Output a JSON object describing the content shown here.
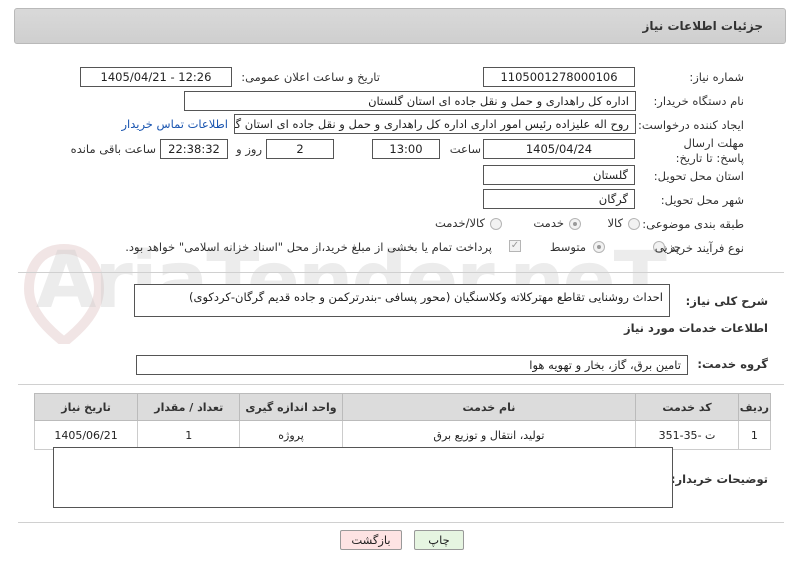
{
  "header": {
    "title": "جزئیات اطلاعات نیاز"
  },
  "watermark": {
    "text": "AriaTender.neT"
  },
  "fields": {
    "need_number_label": "شماره نیاز:",
    "need_number": "1105001278000106",
    "announce_label": "تاریخ و ساعت اعلان عمومی:",
    "announce_value": "1405/04/21 - 12:26",
    "buyer_label": "نام دستگاه خریدار:",
    "buyer_value": "اداره کل راهداری و حمل و نقل جاده ای استان گلستان",
    "creator_label": "ایجاد کننده درخواست:",
    "creator_value": "روح اله علیزاده رئیس امور اداری اداره کل راهداری و حمل و نقل جاده ای استان گلستان",
    "contact_link": "اطلاعات تماس خریدار",
    "deadline_label": "مهلت ارسال پاسخ: تا تاریخ:",
    "deadline_date": "1405/04/24",
    "time_label": "ساعت",
    "deadline_time": "13:00",
    "days_value": "2",
    "days_label": "روز و",
    "remaining_value": "22:38:32",
    "remaining_label": "ساعت باقی مانده",
    "province_label": "استان محل تحویل:",
    "province_value": "گلستان",
    "city_label": "شهر محل تحویل:",
    "city_value": "گرگان",
    "category_label": "طبقه بندی موضوعی:",
    "category_options": [
      "کالا",
      "خدمت",
      "کالا/خدمت"
    ],
    "purchase_type_label": "نوع فرآیند خرید :",
    "purchase_options": [
      "جزیی",
      "متوسط"
    ],
    "payment_note": "پرداخت تمام یا بخشی از مبلغ خرید،از محل \"اسناد خزانه اسلامی\" خواهد بود."
  },
  "description": {
    "label": "شرح کلی نیاز:",
    "value": "احداث روشنایی تقاطع مهترکلاته وکلاسنگیان (محور پسافی -بندرترکمن و جاده قدیم گرگان-کردکوی)"
  },
  "services": {
    "section_title": "اطلاعات خدمات مورد نیاز",
    "group_label": "گروه خدمت:",
    "group_value": "تامین برق، گاز، بخار و تهویه هوا",
    "table": {
      "headers": [
        "ردیف",
        "کد خدمت",
        "نام خدمت",
        "واحد اندازه گیری",
        "تعداد / مقدار",
        "تاریخ نیاز"
      ],
      "rows": [
        [
          "1",
          "ت -35-351",
          "تولید، انتقال و توزیع برق",
          "پروژه",
          "1",
          "1405/06/21"
        ]
      ]
    }
  },
  "buyer_notes": {
    "label": "توضیحات خریدار:",
    "value": ""
  },
  "buttons": {
    "print": "چاپ",
    "back": "بازگشت"
  },
  "colors": {
    "link": "#1a55b0",
    "back_button_bg": "#fde3e3",
    "print_button_bg": "#e6f5e1",
    "header_bg": "#d4d4d4"
  }
}
